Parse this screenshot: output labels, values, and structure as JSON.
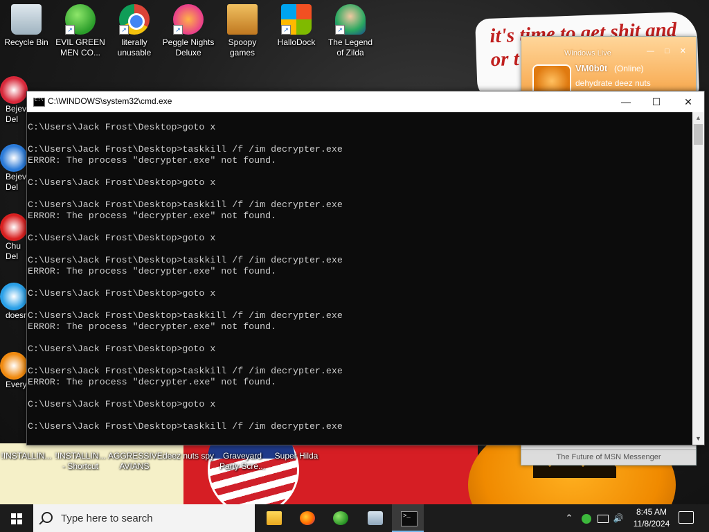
{
  "wallpaper": {
    "note_text": "it's time to get shit and or t"
  },
  "desktop_icons": [
    {
      "name": "recycle-bin-icon",
      "label": "Recycle Bin",
      "style": "ico-recycle",
      "shortcut": false
    },
    {
      "name": "msn-icon",
      "label": "EVIL GREEN MEN CO...",
      "style": "ico-green",
      "shortcut": true
    },
    {
      "name": "chrome-icon",
      "label": "literally unusable",
      "style": "ico-chrome",
      "shortcut": true
    },
    {
      "name": "peggle-icon",
      "label": "Peggle Nights Deluxe",
      "style": "ico-peggle",
      "shortcut": true
    },
    {
      "name": "folder-icon",
      "label": "Spoopy games",
      "style": "ico-spoopy",
      "shortcut": false
    },
    {
      "name": "windows-logo-icon",
      "label": "HalloDock",
      "style": "ico-hallo",
      "shortcut": true
    },
    {
      "name": "zilda-icon",
      "label": "The Legend of Zilda",
      "style": "ico-zilda",
      "shortcut": true
    }
  ],
  "side_icons": [
    {
      "label": "Bejev\nDel",
      "color": "#d8283a"
    },
    {
      "label": "Bejev\nDel",
      "color": "#2a7ad8"
    },
    {
      "label": "Chu\nDel",
      "color": "#d82020"
    },
    {
      "label": "doesn",
      "color": "#2aa0e8"
    },
    {
      "label": "Every",
      "color": "#f08a10"
    }
  ],
  "bottom_icons": [
    {
      "label": "!INSTALLIN...",
      "shortcut": false
    },
    {
      "label": "!INSTALLIN... - Shortcut",
      "shortcut": true
    },
    {
      "label": "AGGRESSIVE AVIANS",
      "shortcut": true
    },
    {
      "label": "deez nuts spy",
      "shortcut": true
    },
    {
      "label": "Graveyard Party Scre...",
      "shortcut": true
    },
    {
      "label": "Super Hilda",
      "shortcut": false
    }
  ],
  "msn": {
    "title": "Windows Live",
    "controls": "— □ ✕",
    "display_name": "VM0b0t",
    "status": "(Online)",
    "personal_message": "dehydrate deez nuts",
    "footer": "The Future of MSN Messenger"
  },
  "cmd": {
    "title": "C:\\WINDOWS\\system32\\cmd.exe",
    "minimize": "—",
    "maximize": "☐",
    "close": "✕",
    "lines": [
      "C:\\Users\\Jack Frost\\Desktop>goto x",
      "",
      "C:\\Users\\Jack Frost\\Desktop>taskkill /f /im decrypter.exe",
      "ERROR: The process \"decrypter.exe\" not found.",
      "",
      "C:\\Users\\Jack Frost\\Desktop>goto x",
      "",
      "C:\\Users\\Jack Frost\\Desktop>taskkill /f /im decrypter.exe",
      "ERROR: The process \"decrypter.exe\" not found.",
      "",
      "C:\\Users\\Jack Frost\\Desktop>goto x",
      "",
      "C:\\Users\\Jack Frost\\Desktop>taskkill /f /im decrypter.exe",
      "ERROR: The process \"decrypter.exe\" not found.",
      "",
      "C:\\Users\\Jack Frost\\Desktop>goto x",
      "",
      "C:\\Users\\Jack Frost\\Desktop>taskkill /f /im decrypter.exe",
      "ERROR: The process \"decrypter.exe\" not found.",
      "",
      "C:\\Users\\Jack Frost\\Desktop>goto x",
      "",
      "C:\\Users\\Jack Frost\\Desktop>taskkill /f /im decrypter.exe",
      "ERROR: The process \"decrypter.exe\" not found.",
      "",
      "C:\\Users\\Jack Frost\\Desktop>goto x",
      "",
      "C:\\Users\\Jack Frost\\Desktop>taskkill /f /im decrypter.exe"
    ]
  },
  "taskbar": {
    "search_placeholder": "Type here to search",
    "apps": [
      {
        "name": "file-explorer-icon",
        "glyph": "g-folder",
        "active": false
      },
      {
        "name": "firefox-icon",
        "glyph": "g-firefox",
        "active": false
      },
      {
        "name": "msn-messenger-icon",
        "glyph": "g-msn",
        "active": false
      },
      {
        "name": "network-app-icon",
        "glyph": "g-net",
        "active": false
      },
      {
        "name": "cmd-icon",
        "glyph": "g-cmd",
        "active": true
      }
    ],
    "tray": {
      "chevron": "⌃",
      "volume": "🔊"
    },
    "time": "8:45 AM",
    "date": "11/8/2024"
  }
}
